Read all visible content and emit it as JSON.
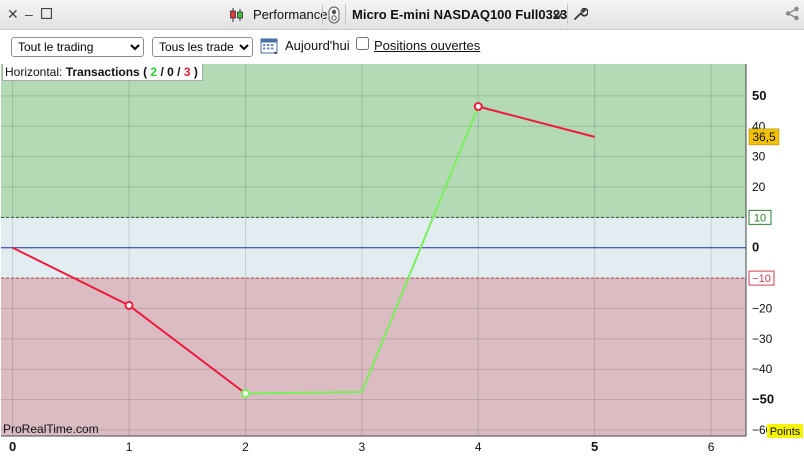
{
  "window": {
    "performance_label": "Performance",
    "instrument": "Micro E-mini NASDAQ100 Full0323"
  },
  "toolbar": {
    "scope_select": "Tout le trading",
    "trades_select": "Tous les trades",
    "date_label": "Aujourd'hui",
    "open_positions_label": "Positions ouvertes",
    "open_positions_checked": false
  },
  "info": {
    "mode": "Horizontal:",
    "label": "Transactions",
    "open_paren": "(",
    "winners": "2",
    "sep1": "/",
    "breakeven": "0",
    "sep2": "/",
    "losers": "3",
    "close_paren": ")"
  },
  "watermark": "ProRealTime.com",
  "colors": {
    "up_zone": "#b3d9b5",
    "neutral_zone": "#e2edf2",
    "down_zone": "#dbbcc3",
    "win_line": "#79f05a",
    "loss_line": "#ee1b3d",
    "zero_line": "#2233aa",
    "last_value_bg": "#f2c200",
    "units_bg": "#f7f400"
  },
  "chart_data": {
    "type": "line",
    "x": [
      0,
      1,
      2,
      3,
      4,
      5
    ],
    "y": [
      0,
      -19,
      -48,
      -47.5,
      46.5,
      36.5
    ],
    "segments": [
      "loss",
      "loss",
      "win",
      "win",
      "loss"
    ],
    "marked_points": [
      1,
      2,
      4
    ],
    "xlim": [
      -0.1,
      6.3
    ],
    "ylim": [
      -62,
      60.5
    ],
    "x_ticks": [
      "0",
      "1",
      "2",
      "3",
      "4",
      "5",
      "6"
    ],
    "y_ticks": [
      "50",
      "40",
      "30",
      "20",
      "0",
      "-20",
      "-30",
      "-40",
      "-50",
      "-60"
    ],
    "upper_threshold": 10,
    "lower_threshold": -10,
    "upper_threshold_label": "10",
    "lower_threshold_label": "-10",
    "last_value_label": "36,5",
    "units_label": "Points",
    "grid": true
  }
}
